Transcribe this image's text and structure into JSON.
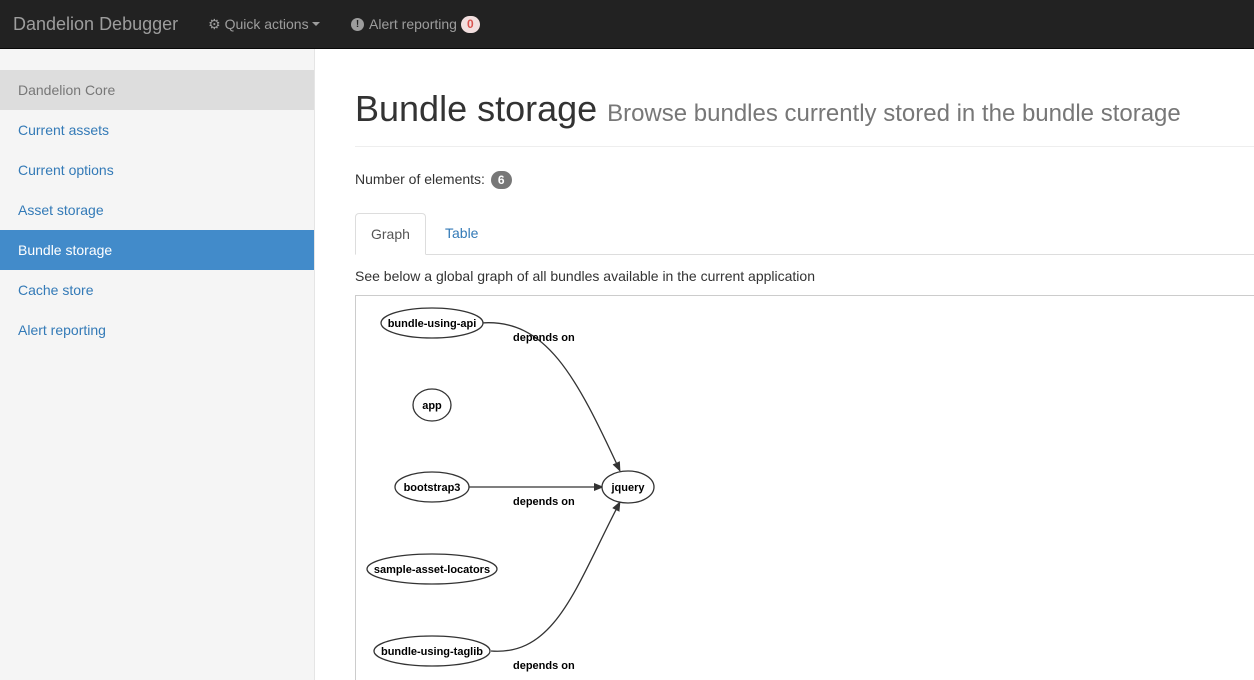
{
  "navbar": {
    "brand": "Dandelion Debugger",
    "quick_actions_label": "Quick actions",
    "alert_label": "Alert reporting",
    "alert_count": "0"
  },
  "sidebar": {
    "items": [
      {
        "label": "Dandelion Core"
      },
      {
        "label": "Current assets"
      },
      {
        "label": "Current options"
      },
      {
        "label": "Asset storage"
      },
      {
        "label": "Bundle storage"
      },
      {
        "label": "Cache store"
      },
      {
        "label": "Alert reporting"
      }
    ]
  },
  "main": {
    "title": "Bundle storage",
    "subtitle": "Browse bundles currently stored in the bundle storage",
    "count_label": "Number of elements:",
    "count_value": "6",
    "tabs": [
      {
        "label": "Graph"
      },
      {
        "label": "Table"
      }
    ],
    "intro": "See below a global graph of all bundles available in the current application"
  },
  "graph": {
    "nodes": [
      {
        "id": "bundle-using-api",
        "label": "bundle-using-api"
      },
      {
        "id": "app",
        "label": "app"
      },
      {
        "id": "bootstrap3",
        "label": "bootstrap3"
      },
      {
        "id": "sample-asset-locators",
        "label": "sample-asset-locators"
      },
      {
        "id": "bundle-using-taglib",
        "label": "bundle-using-taglib"
      },
      {
        "id": "jquery",
        "label": "jquery"
      }
    ],
    "edges": [
      {
        "from": "bundle-using-api",
        "to": "jquery",
        "label": "depends on"
      },
      {
        "from": "bootstrap3",
        "to": "jquery",
        "label": "depends on"
      },
      {
        "from": "bundle-using-taglib",
        "to": "jquery",
        "label": "depends on"
      }
    ]
  }
}
